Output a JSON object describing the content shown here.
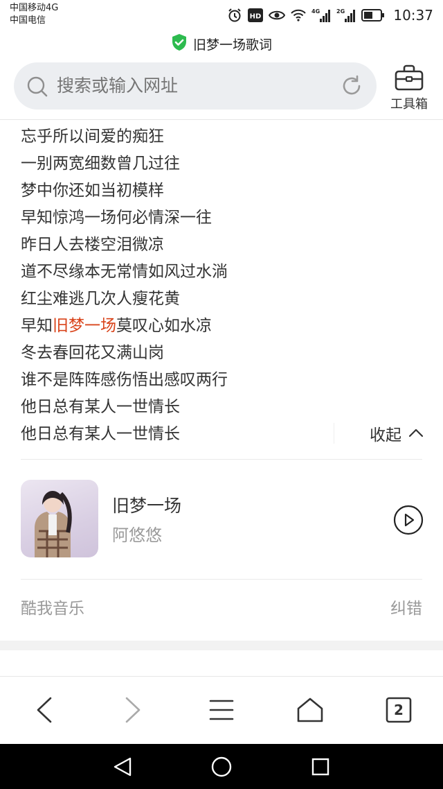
{
  "status_bar": {
    "carrier_1": "中国移动4G",
    "carrier_2": "中国电信",
    "hd_badge": "HD",
    "signal_1_label": "4G",
    "signal_2_label": "2G",
    "time": "10:37",
    "icons": [
      "alarm-icon",
      "hd-icon",
      "eye-icon",
      "wifi-icon",
      "signal-4g-icon",
      "signal-2g-icon",
      "battery-icon"
    ]
  },
  "title_bar": {
    "title": "旧梦一场歌词",
    "icon": "shield-check-icon",
    "accent_color": "#2dbb4f"
  },
  "search": {
    "placeholder": "搜索或输入网址",
    "toolbox_label": "工具箱"
  },
  "lyrics": {
    "lines": [
      {
        "before": "忘乎所以间爱的痴狂",
        "highlight": "",
        "after": ""
      },
      {
        "before": "一别两宽细数曾几过往",
        "highlight": "",
        "after": ""
      },
      {
        "before": "梦中你还如当初模样",
        "highlight": "",
        "after": ""
      },
      {
        "before": "早知惊鸿一场何必情深一往",
        "highlight": "",
        "after": ""
      },
      {
        "before": "昨日人去楼空泪微凉",
        "highlight": "",
        "after": ""
      },
      {
        "before": "道不尽缘本无常情如风过水淌",
        "highlight": "",
        "after": ""
      },
      {
        "before": "红尘难逃几次人瘦花黄",
        "highlight": "",
        "after": ""
      },
      {
        "before": "早知",
        "highlight": "旧梦一场",
        "after": "莫叹心如水凉"
      },
      {
        "before": "冬去春回花又满山岗",
        "highlight": "",
        "after": ""
      },
      {
        "before": "谁不是阵阵感伤悟出感叹两行",
        "highlight": "",
        "after": ""
      },
      {
        "before": "他日总有某人一世情长",
        "highlight": "",
        "after": ""
      },
      {
        "before": "他日总有某人一世情长",
        "highlight": "",
        "after": ""
      }
    ],
    "highlight_color": "#d9441b",
    "collapse_label": "收起"
  },
  "song": {
    "title": "旧梦一场",
    "artist": "阿悠悠"
  },
  "footer": {
    "source": "酷我音乐",
    "report": "纠错"
  },
  "browser_nav": {
    "tabs_count": "2"
  }
}
